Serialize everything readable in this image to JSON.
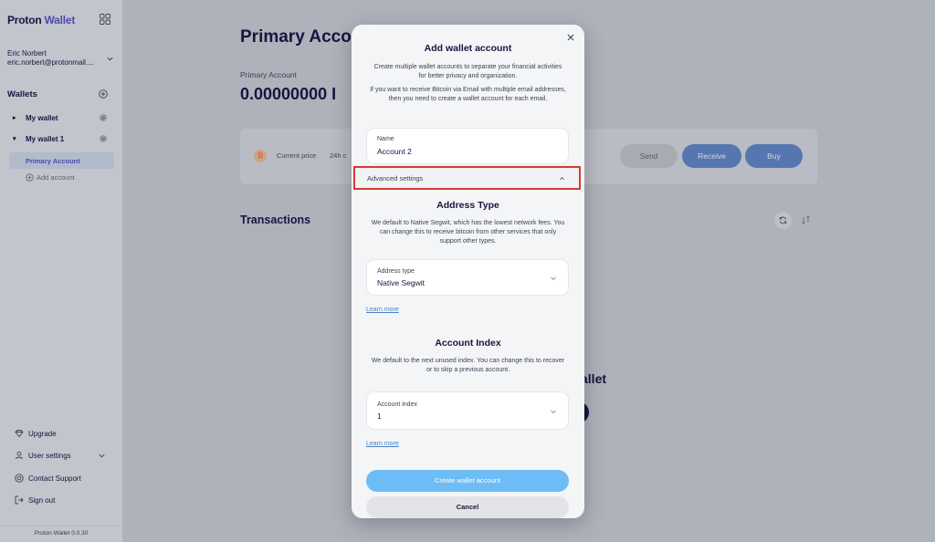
{
  "sidebar": {
    "brand_part1": "Proton",
    "brand_part2": "Wallet",
    "user_name": "Eric Norbert",
    "user_email": "eric.norbert@protonmail....",
    "wallets_title": "Wallets",
    "wallets": [
      {
        "label": "My wallet",
        "expanded": false
      },
      {
        "label": "My wallet 1",
        "expanded": true
      }
    ],
    "active_account": "Primary Account",
    "add_account": "Add account",
    "bottom": {
      "upgrade": "Upgrade",
      "user_settings": "User settings",
      "contact_support": "Contact Support",
      "sign_out": "Sign out"
    },
    "version": "Proton Wallet 0.0.30"
  },
  "main": {
    "title": "Primary Accou",
    "account_label": "Primary Account",
    "balance": "0.00000000 I",
    "current_price_label": "Current price",
    "h24_label": "24h c",
    "send": "Send",
    "receive": "Receive",
    "buy": "Buy",
    "transactions_title": "Transactions",
    "empty_title_fragment": "allet"
  },
  "modal": {
    "title": "Add wallet account",
    "desc1": "Create multiple wallet accounts to separate your financial activities for better privacy and organization.",
    "desc2": "If you want to receive Bitcoin via Email with multiple email addresses, then you need to create a wallet account for each email.",
    "name_label": "Name",
    "name_value": "Account 2",
    "advanced_settings": "Advanced settings",
    "address_type_title": "Address Type",
    "address_type_desc": "We default to Native Segwit, which has the lowest network fees. You can change this to receive bitcoin from other services that only support other types.",
    "address_type_label": "Address type",
    "address_type_value": "Native Segwit",
    "learn_more": "Learn more",
    "account_index_title": "Account Index",
    "account_index_desc": "We default to the next unused index. You can change this to recover or to skip a previous account.",
    "account_index_label": "Account index",
    "account_index_value": "1",
    "create_button": "Create wallet account",
    "cancel_button": "Cancel"
  },
  "colors": {
    "brand_text": "#1b1340",
    "brand_accent": "#4d4ab0",
    "create_button": "#6dbcf5",
    "highlight_border": "#d93a2f",
    "link": "#4a83c7"
  }
}
